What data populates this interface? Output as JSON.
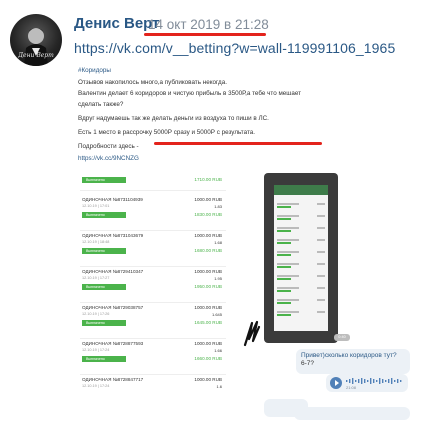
{
  "post": {
    "author": "Денис Верт",
    "timestamp": "14 окт 2019 в 21:28",
    "link": "https://vk.com/v__betting?w=wall-119991106_1965",
    "avatar_caption": "Дени Верт"
  },
  "screenshot": {
    "hashtag": "#Коридоры",
    "lines": [
      "Отзывов накопилось много,а публиковать некогда.",
      "Валентин делает 6 коридоров и чистую прибыль в 3500Р,а тебе что мешает",
      "сделать также?",
      "Вдруг надумаешь так же делать деньги из воздуха то пиши в ЛС.",
      "Есть 1 место в рассрочку 5000Р сразу и 5000Р с результата.",
      "Подробности здесь -"
    ],
    "details_link": "https://vk.cc/9NCNZG",
    "bets": [
      {
        "title": "",
        "sub": "",
        "amount": "",
        "coef": "",
        "badge": "Выплачено",
        "win": "1710.00 RUB"
      },
      {
        "title": "ОДИНОЧНАЯ №8731104939",
        "sub": "12.10.19 | 17:01",
        "amount": "1000.00 RUB",
        "coef": "1.83",
        "badge": "Выплачено",
        "win": "1830.00 RUB"
      },
      {
        "title": "ОДИНОЧНАЯ №8731043679",
        "sub": "12.10.19 | 18:48",
        "amount": "1000.00 RUB",
        "coef": "1.68",
        "badge": "Выплачено",
        "win": "1680.00 RUB"
      },
      {
        "title": "ОДИНОЧНАЯ №8729410347",
        "sub": "12.10.19 | 17:27",
        "amount": "1000.00 RUB",
        "coef": "1.95",
        "badge": "Выплачено",
        "win": "1950.00 RUB"
      },
      {
        "title": "ОДИНОЧНАЯ №8729038757",
        "sub": "12.10.19 | 17:26",
        "amount": "1000.00 RUB",
        "coef": "1.645",
        "badge": "Выплачено",
        "win": "1645.00 RUB"
      },
      {
        "title": "ОДИНОЧНАЯ №8728877593",
        "sub": "12.10.19 | 17:24",
        "amount": "1000.00 RUB",
        "coef": "1.66",
        "badge": "Выплачено",
        "win": "1660.00 RUB"
      },
      {
        "title": "ОДИНОЧНАЯ №8728847717",
        "sub": "12.10.19 | 17:24",
        "amount": "1000.00 RUB",
        "coef": "1.6",
        "badge": "",
        "win": ""
      }
    ],
    "chat": {
      "question_line1": "Привет)сколько коридоров тут?",
      "question_line2": "6-7?",
      "voice_time": "21:08",
      "phone_time": "0:40"
    }
  },
  "colors": {
    "link": "#2a5885",
    "meta": "#818c99",
    "accent_underline": "#e3231c",
    "win_green": "#4bb34b"
  }
}
